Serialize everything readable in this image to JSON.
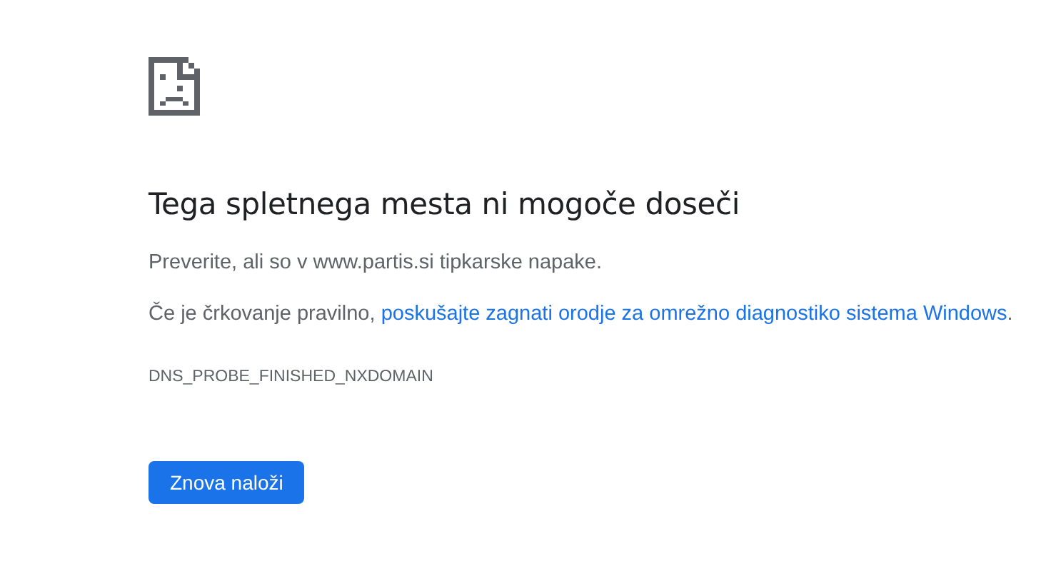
{
  "heading": "Tega spletnega mesta ni mogoče doseči",
  "suggestion": "Preverite, ali so v www.partis.si tipkarske napake.",
  "diagnostics": {
    "prefix": "Če je črkovanje pravilno, ",
    "link": "poskušajte zagnati orodje za omrežno diagnostiko sistema Windows",
    "suffix": "."
  },
  "error_code": "DNS_PROBE_FINISHED_NXDOMAIN",
  "button": "Znova naloži"
}
